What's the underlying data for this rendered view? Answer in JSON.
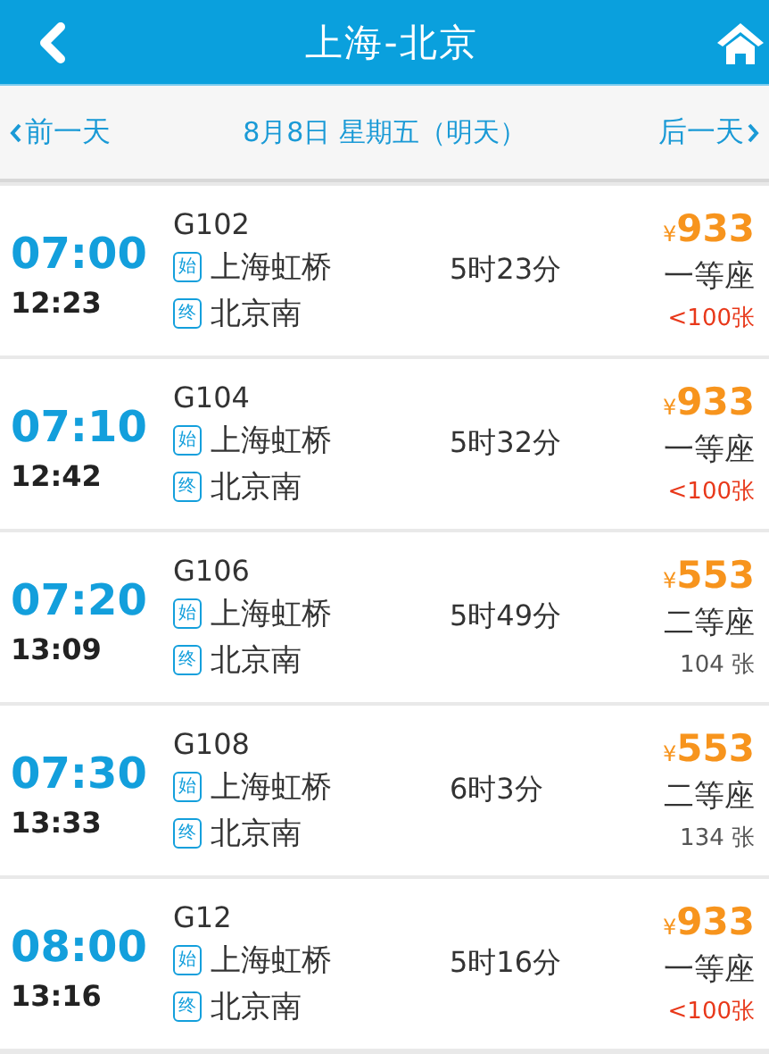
{
  "header": {
    "title": "上海-北京"
  },
  "date_bar": {
    "prev": "前一天",
    "date": "8月8日 星期五（明天）",
    "next": "后一天"
  },
  "trains": [
    {
      "depart": "07:00",
      "arrive": "12:23",
      "number": "G102",
      "from_badge": "始",
      "from": "上海虹桥",
      "to_badge": "终",
      "to": "北京南",
      "duration": "5时23分",
      "currency": "¥",
      "price": "933",
      "seat": "一等座",
      "tickets": "<100张",
      "few": true
    },
    {
      "depart": "07:10",
      "arrive": "12:42",
      "number": "G104",
      "from_badge": "始",
      "from": "上海虹桥",
      "to_badge": "终",
      "to": "北京南",
      "duration": "5时32分",
      "currency": "¥",
      "price": "933",
      "seat": "一等座",
      "tickets": "<100张",
      "few": true
    },
    {
      "depart": "07:20",
      "arrive": "13:09",
      "number": "G106",
      "from_badge": "始",
      "from": "上海虹桥",
      "to_badge": "终",
      "to": "北京南",
      "duration": "5时49分",
      "currency": "¥",
      "price": "553",
      "seat": "二等座",
      "tickets": "104 张",
      "few": false
    },
    {
      "depart": "07:30",
      "arrive": "13:33",
      "number": "G108",
      "from_badge": "始",
      "from": "上海虹桥",
      "to_badge": "终",
      "to": "北京南",
      "duration": "6时3分",
      "currency": "¥",
      "price": "553",
      "seat": "二等座",
      "tickets": "134 张",
      "few": false
    },
    {
      "depart": "08:00",
      "arrive": "13:16",
      "number": "G12",
      "from_badge": "始",
      "from": "上海虹桥",
      "to_badge": "终",
      "to": "北京南",
      "duration": "5时16分",
      "currency": "¥",
      "price": "933",
      "seat": "一等座",
      "tickets": "<100张",
      "few": true
    }
  ]
}
